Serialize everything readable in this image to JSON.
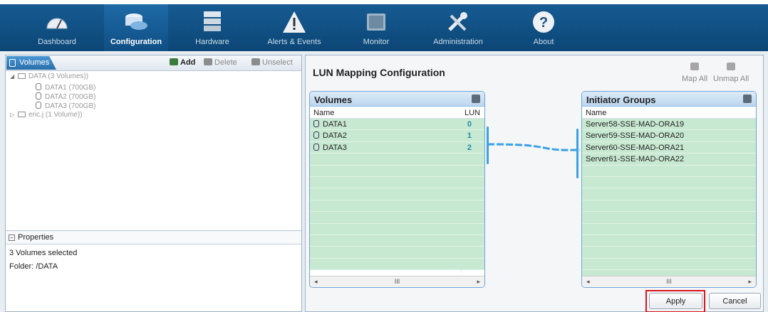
{
  "nav": {
    "items": [
      {
        "label": "Dashboard",
        "icon": "gauge-icon"
      },
      {
        "label": "Configuration",
        "icon": "database-icon"
      },
      {
        "label": "Hardware",
        "icon": "server-icon"
      },
      {
        "label": "Alerts & Events",
        "icon": "warning-icon"
      },
      {
        "label": "Monitor",
        "icon": "monitor-icon"
      },
      {
        "label": "Administration",
        "icon": "tools-icon"
      },
      {
        "label": "About",
        "icon": "help-icon"
      }
    ],
    "active": "Configuration"
  },
  "left": {
    "tab": "Volumes",
    "toolbar": {
      "add": "Add",
      "delete": "Delete",
      "unselect": "Unselect"
    },
    "tree": [
      {
        "label": "DATA (3 Volumes))",
        "type": "folder",
        "expanded": true
      },
      {
        "label": "DATA1 (700GB)",
        "type": "volume"
      },
      {
        "label": "DATA2 (700GB)",
        "type": "volume"
      },
      {
        "label": "DATA3 (700GB)",
        "type": "volume"
      },
      {
        "label": "eric.j (1 Volume))",
        "type": "folder",
        "expanded": false
      }
    ],
    "properties": {
      "title": "Properties",
      "lines": [
        "3 Volumes selected",
        "Folder:  /DATA"
      ]
    }
  },
  "right": {
    "title": "LUN Mapping Configuration",
    "map_all": "Map All",
    "unmap_all": "Unmap All",
    "volumes": {
      "title": "Volumes",
      "col_name": "Name",
      "col_lun": "LUN",
      "rows": [
        {
          "name": "DATA1",
          "lun": "0"
        },
        {
          "name": "DATA2",
          "lun": "1"
        },
        {
          "name": "DATA3",
          "lun": "2"
        }
      ]
    },
    "initiators": {
      "title": "Initiator Groups",
      "col_name": "Name",
      "rows": [
        "Server58-SSE-MAD-ORA19",
        "Server59-SSE-MAD-ORA20",
        "Server60-SSE-MAD-ORA21",
        "Server61-SSE-MAD-ORA22"
      ]
    },
    "scroll_mark": "III",
    "apply": "Apply",
    "cancel": "Cancel"
  },
  "colors": {
    "nav_bg": "#0e4a7a",
    "row_green": "#c8e9d1",
    "link_blue": "#3aa0e8",
    "highlight": "#d9161c"
  }
}
